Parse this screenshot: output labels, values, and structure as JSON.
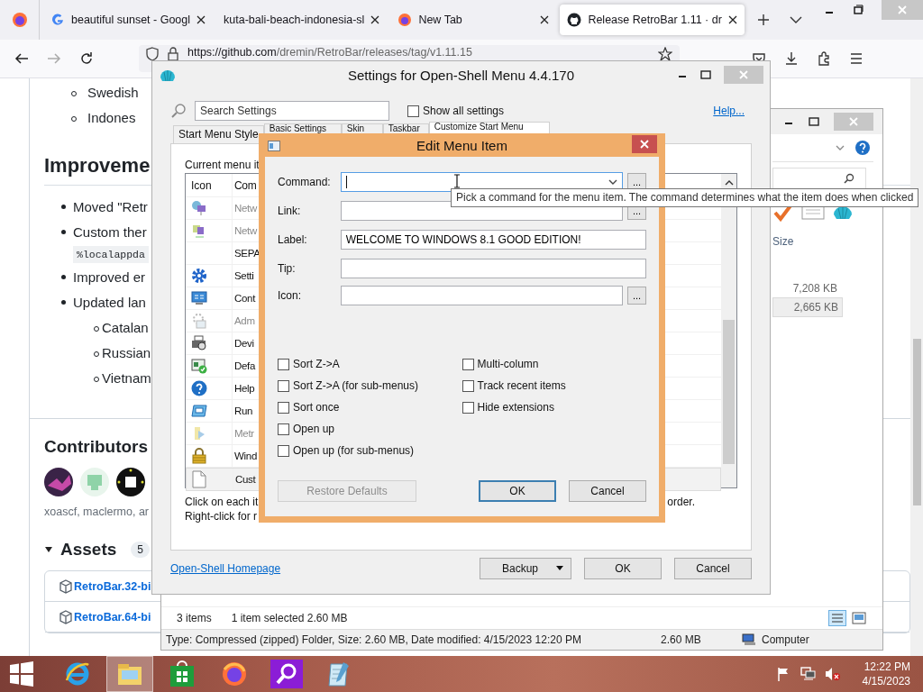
{
  "browser": {
    "tabs": [
      {
        "label": "beautiful sunset - Googl",
        "kind": "google",
        "selected": false
      },
      {
        "label": "kuta-bali-beach-indonesia-sl",
        "kind": "plain",
        "selected": false
      },
      {
        "label": "New Tab",
        "kind": "firefox",
        "selected": false
      },
      {
        "label": "Release RetroBar 1.11 · dr",
        "kind": "github",
        "selected": true
      }
    ],
    "url_host": "https://github.com",
    "url_path": "/dremin/RetroBar/releases/tag/v1.11.15"
  },
  "page": {
    "languages_top": [
      "Swedish",
      "Indones"
    ],
    "heading": "Improveme",
    "items": [
      {
        "text": "Moved \"Retr"
      },
      {
        "text": "Custom ther",
        "code": "%localappda"
      },
      {
        "text": "Improved er"
      },
      {
        "text": "Updated lan",
        "children": [
          {
            "text": "Catalan"
          },
          {
            "text": "Russian"
          },
          {
            "text": "Vietnam"
          }
        ]
      }
    ],
    "contributors_title": "Contributors",
    "contributors_names": "xoascf, maclermo, ar",
    "assets_title": "Assets",
    "assets_count": "5",
    "assets": [
      "RetroBar.32-bi",
      "RetroBar.64-bi"
    ]
  },
  "explorer": {
    "column": "Size",
    "rows": [
      {
        "size": "7,208 KB",
        "selected": false
      },
      {
        "size": "2,665 KB",
        "selected": true
      }
    ],
    "status_count": "3 items",
    "status_selected": "1 item selected  2.60 MB",
    "details": "Type: Compressed (zipped) Folder, Size: 2.60 MB, Date modified: 4/15/2023 12:20 PM",
    "details_size": "2.60 MB",
    "location": "Computer"
  },
  "settings": {
    "title": "Settings for Open-Shell Menu 4.4.170",
    "search": {
      "placeholder": "Search Settings"
    },
    "show_all": {
      "label": "Show all settings",
      "checked": false
    },
    "help": "Help...",
    "tabs": [
      {
        "label": "Start Menu Style",
        "selected": false
      },
      {
        "label": "Basic Settings",
        "selected": false
      },
      {
        "label": "Skin",
        "selected": false
      },
      {
        "label": "Taskbar",
        "selected": false
      },
      {
        "label": "Customize Start Menu",
        "selected": true
      }
    ],
    "list_label": "Current menu it",
    "columns": [
      "Icon",
      "Com"
    ],
    "rows": [
      {
        "text": "Netw",
        "kind": "network",
        "disabled": true,
        "selected": false
      },
      {
        "text": "Netw",
        "kind": "connections",
        "disabled": true,
        "selected": false
      },
      {
        "text": "SEPA",
        "kind": "separator",
        "disabled": false,
        "selected": false
      },
      {
        "text": "Setti",
        "kind": "gear",
        "disabled": false,
        "selected": false
      },
      {
        "text": "Cont",
        "kind": "control",
        "disabled": false,
        "selected": false
      },
      {
        "text": "Adm",
        "kind": "admin",
        "disabled": true,
        "selected": false
      },
      {
        "text": "Devi",
        "kind": "printer",
        "disabled": false,
        "selected": false
      },
      {
        "text": "Defa",
        "kind": "defaults",
        "disabled": false,
        "selected": false
      },
      {
        "text": "Help",
        "kind": "help",
        "disabled": false,
        "selected": false
      },
      {
        "text": "Run",
        "kind": "run",
        "disabled": false,
        "selected": false
      },
      {
        "text": "Metr",
        "kind": "metro",
        "disabled": true,
        "selected": false
      },
      {
        "text": "Wind",
        "kind": "lock",
        "disabled": false,
        "selected": false
      },
      {
        "text": "Cust",
        "kind": "file",
        "disabled": false,
        "selected": true
      }
    ],
    "hints": [
      "Click on each it",
      "Right-click for r"
    ],
    "hint_end": "order.",
    "homepage": "Open-Shell Homepage",
    "buttons": {
      "backup": "Backup",
      "ok": "OK",
      "cancel": "Cancel"
    }
  },
  "edit": {
    "title": "Edit Menu Item",
    "fields": [
      {
        "label": "Command:",
        "kind": "combo",
        "browse": "..."
      },
      {
        "label": "Link:",
        "kind": "text",
        "browse": "..."
      },
      {
        "label": "Label:",
        "kind": "text",
        "value": "WELCOME TO WINDOWS 8.1 GOOD EDITION!"
      },
      {
        "label": "Tip:",
        "kind": "text"
      },
      {
        "label": "Icon:",
        "kind": "text",
        "browse": "..."
      }
    ],
    "options_left": [
      {
        "label": "Sort Z->A",
        "checked": false
      },
      {
        "label": "Sort Z->A (for sub-menus)",
        "checked": false
      },
      {
        "label": "Sort once",
        "checked": false
      },
      {
        "label": "Open up",
        "checked": false
      },
      {
        "label": "Open up (for sub-menus)",
        "checked": false
      }
    ],
    "options_right": [
      {
        "label": "Multi-column",
        "checked": false
      },
      {
        "label": "Track recent items",
        "checked": false
      },
      {
        "label": "Hide extensions",
        "checked": false
      }
    ],
    "buttons": [
      {
        "label": "Restore Defaults",
        "disabled": true,
        "default": false
      },
      {
        "label": "OK",
        "disabled": false,
        "default": true
      },
      {
        "label": "Cancel",
        "disabled": false,
        "default": false
      }
    ],
    "tooltip": "Pick a command for the menu item. The command determines what the item does when clicked"
  },
  "taskbar": {
    "apps": [
      {
        "kind": "ie",
        "active": false
      },
      {
        "kind": "explorer",
        "active": true
      },
      {
        "kind": "store",
        "active": false
      },
      {
        "kind": "firefox",
        "active": false
      },
      {
        "kind": "search",
        "active": false
      },
      {
        "kind": "notepad",
        "active": false
      }
    ],
    "time": "12:22 PM",
    "date": "4/15/2023"
  }
}
